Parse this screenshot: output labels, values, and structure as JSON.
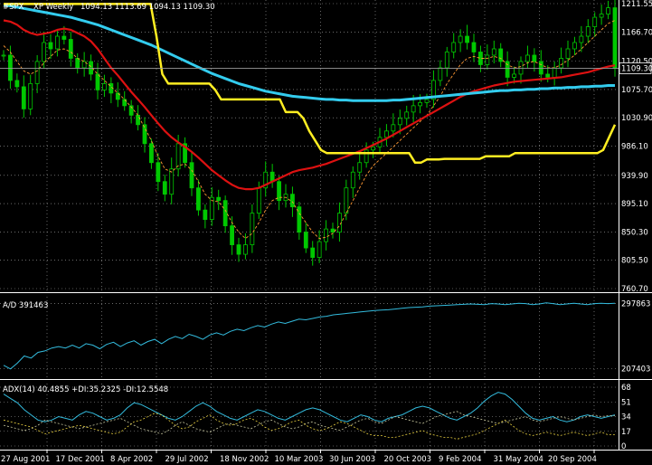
{
  "header": {
    "symbol": "#SPX",
    "timeframe": "XP Weekly",
    "ohlc": "1094.13 1113.69 1094.13 1109.30",
    "current_price": "1109.30"
  },
  "colors": {
    "background": "#000000",
    "grid": "#a9a9a9",
    "candles": "#00c800",
    "ma_fast": "#ff9933",
    "ma_mid": "#dd1111",
    "ma_slow": "#33ccee",
    "stop_line": "#ffee22",
    "ad_line": "#33bbdd",
    "adx_main": "#33bbdd",
    "adx_plus": "#c8c8a0",
    "adx_minus": "#e8d040",
    "price_marker": "#000000"
  },
  "chart_data": [
    {
      "type": "line",
      "name": "price",
      "title": "#SPX, XP Weekly",
      "y_ticks": [
        "1211.55",
        "1166.70",
        "1120.50",
        "1075.70",
        "1030.90",
        "986.10",
        "939.90",
        "895.10",
        "850.30",
        "805.50",
        "760.70"
      ],
      "ylim": [
        760.7,
        1211.55
      ],
      "x_labels": [
        "27 Aug 2001",
        "17 Dec 2001",
        "8 Apr 2002",
        "29 Jul 2002",
        "18 Nov 2002",
        "10 Mar 2003",
        "30 Jun 2003",
        "20 Oct 2003",
        "9 Feb 2004",
        "31 May 2004",
        "20 Sep 2004"
      ],
      "candles": {
        "close": [
          1130,
          1090,
          1080,
          1045,
          1085,
          1120,
          1150,
          1140,
          1160,
          1155,
          1125,
          1110,
          1120,
          1100,
          1075,
          1085,
          1070,
          1060,
          1050,
          1035,
          1020,
          990,
          960,
          930,
          910,
          950,
          990,
          960,
          920,
          885,
          870,
          905,
          900,
          860,
          830,
          815,
          830,
          880,
          920,
          945,
          930,
          900,
          910,
          890,
          850,
          825,
          810,
          835,
          855,
          850,
          880,
          920,
          945,
          960,
          980,
          985,
          1000,
          1010,
          1020,
          1030,
          1040,
          1050,
          1055,
          1060,
          1090,
          1110,
          1135,
          1150,
          1160,
          1150,
          1135,
          1115,
          1130,
          1140,
          1120,
          1095,
          1100,
          1120,
          1130,
          1120,
          1100,
          1095,
          1110,
          1125,
          1140,
          1150,
          1160,
          1175,
          1190,
          1195,
          1205,
          1109
        ]
      },
      "series": [
        {
          "name": "ma_fast",
          "values": [
            1145,
            1135,
            1120,
            1105,
            1100,
            1105,
            1118,
            1128,
            1138,
            1140,
            1135,
            1125,
            1120,
            1112,
            1100,
            1090,
            1080,
            1070,
            1060,
            1048,
            1035,
            1015,
            995,
            970,
            950,
            945,
            955,
            958,
            948,
            930,
            910,
            900,
            898,
            885,
            865,
            850,
            840,
            848,
            865,
            885,
            900,
            905,
            905,
            898,
            880,
            865,
            850,
            840,
            842,
            848,
            860,
            880,
            900,
            920,
            940,
            955,
            965,
            975,
            985,
            995,
            1005,
            1015,
            1025,
            1035,
            1050,
            1065,
            1085,
            1100,
            1115,
            1125,
            1128,
            1125,
            1125,
            1128,
            1125,
            1115,
            1110,
            1112,
            1118,
            1120,
            1115,
            1110,
            1110,
            1115,
            1122,
            1130,
            1140,
            1150,
            1160,
            1170,
            1180,
            1185
          ]
        },
        {
          "name": "ma_mid",
          "values": [
            1185,
            1183,
            1178,
            1170,
            1165,
            1162,
            1164,
            1166,
            1170,
            1172,
            1170,
            1165,
            1160,
            1152,
            1140,
            1125,
            1110,
            1098,
            1085,
            1072,
            1060,
            1048,
            1035,
            1022,
            1010,
            1000,
            992,
            985,
            977,
            968,
            958,
            948,
            940,
            932,
            925,
            920,
            918,
            918,
            920,
            925,
            930,
            935,
            940,
            945,
            948,
            950,
            952,
            955,
            958,
            962,
            966,
            970,
            974,
            978,
            983,
            988,
            993,
            998,
            1004,
            1010,
            1016,
            1022,
            1028,
            1034,
            1040,
            1046,
            1052,
            1058,
            1064,
            1069,
            1073,
            1076,
            1079,
            1082,
            1084,
            1086,
            1088,
            1089,
            1090,
            1091,
            1092,
            1093,
            1094,
            1095,
            1097,
            1099,
            1101,
            1103,
            1106,
            1109,
            1112,
            1114
          ]
        },
        {
          "name": "ma_slow",
          "values": [
            1210,
            1208,
            1206,
            1204,
            1202,
            1200,
            1198,
            1196,
            1194,
            1192,
            1190,
            1187,
            1184,
            1181,
            1178,
            1174,
            1170,
            1166,
            1162,
            1158,
            1154,
            1150,
            1146,
            1141,
            1136,
            1131,
            1126,
            1121,
            1116,
            1111,
            1106,
            1101,
            1097,
            1093,
            1089,
            1085,
            1082,
            1079,
            1076,
            1073,
            1071,
            1069,
            1067,
            1065,
            1064,
            1063,
            1062,
            1061,
            1060,
            1060,
            1059,
            1059,
            1058,
            1058,
            1058,
            1058,
            1058,
            1058,
            1059,
            1059,
            1060,
            1061,
            1062,
            1063,
            1064,
            1065,
            1066,
            1067,
            1068,
            1069,
            1070,
            1071,
            1072,
            1073,
            1074,
            1074,
            1075,
            1075,
            1076,
            1076,
            1077,
            1077,
            1078,
            1078,
            1079,
            1079,
            1080,
            1080,
            1081,
            1081,
            1082,
            1082
          ]
        },
        {
          "name": "stop_line",
          "values": [
            1211,
            1211,
            1211,
            1211,
            1211,
            1211,
            1211,
            1211,
            1211,
            1211,
            1211,
            1211,
            1211,
            1211,
            1211,
            1211,
            1211,
            1211,
            1211,
            1211,
            1211,
            1211,
            1211,
            1211,
            1211,
            1211,
            1160,
            1100,
            1085,
            1085,
            1085,
            1085,
            1085,
            1085,
            1085,
            1085,
            1075,
            1060,
            1060,
            1060,
            1060,
            1060,
            1060,
            1060,
            1060,
            1060,
            1060,
            1060,
            1040,
            1040,
            1040,
            1030,
            1010,
            995,
            980,
            975,
            975,
            975,
            975,
            975,
            975,
            975,
            975,
            975,
            975,
            975,
            975,
            975,
            975,
            975,
            960,
            960,
            965,
            965,
            965,
            966,
            966,
            966,
            966,
            966,
            966,
            966,
            970,
            970,
            970,
            970,
            970,
            975,
            975,
            975,
            975,
            975,
            975,
            975,
            975,
            975,
            975,
            975,
            975,
            975,
            975,
            975,
            980,
            1000,
            1020
          ]
        }
      ]
    },
    {
      "type": "line",
      "name": "A/D",
      "title": "A/D 391463",
      "y_ticks": [
        "297863",
        "207403"
      ],
      "ylim": [
        198000,
        302000
      ],
      "series": [
        {
          "name": "A/D",
          "values": [
            212000,
            207000,
            215000,
            225000,
            222000,
            230000,
            232000,
            236000,
            238000,
            236000,
            240000,
            236000,
            242000,
            240000,
            235000,
            241000,
            244000,
            238000,
            243000,
            246000,
            240000,
            245000,
            248000,
            242000,
            248000,
            252000,
            249000,
            255000,
            252000,
            248000,
            254000,
            257000,
            254000,
            259000,
            262000,
            260000,
            264000,
            267000,
            265000,
            269000,
            272000,
            270000,
            273000,
            276000,
            275000,
            277000,
            279000,
            280000,
            282000,
            283000,
            284000,
            285000,
            286000,
            287000,
            288000,
            288500,
            289000,
            290000,
            291000,
            292000,
            292500,
            293000,
            294000,
            294500,
            295000,
            295500,
            296000,
            296500,
            297000,
            296500,
            296000,
            297500,
            297000,
            296000,
            297000,
            298000,
            297500,
            296000,
            297000,
            298500,
            297500,
            296000,
            297000,
            298000,
            297000,
            296000,
            297500,
            298000,
            297500,
            297863
          ]
        }
      ]
    },
    {
      "type": "line",
      "name": "ADX",
      "title": "ADX(14) 40.4855 +DI:35.2325 -DI:12.5548",
      "y_ticks": [
        "68",
        "51",
        "34",
        "17",
        "0"
      ],
      "ylim": [
        0,
        68
      ],
      "series": [
        {
          "name": "ADX",
          "values": [
            60,
            55,
            50,
            42,
            36,
            30,
            28,
            30,
            34,
            32,
            30,
            36,
            40,
            38,
            34,
            30,
            32,
            36,
            44,
            50,
            48,
            44,
            40,
            36,
            32,
            30,
            34,
            40,
            46,
            50,
            46,
            40,
            36,
            32,
            30,
            34,
            38,
            42,
            40,
            36,
            32,
            30,
            34,
            38,
            42,
            44,
            42,
            38,
            34,
            30,
            28,
            32,
            36,
            34,
            30,
            28,
            32,
            34,
            36,
            40,
            44,
            46,
            44,
            40,
            36,
            32,
            30,
            34,
            38,
            44,
            52,
            58,
            62,
            60,
            54,
            46,
            38,
            32,
            30,
            32,
            34,
            30,
            28,
            30,
            34,
            36,
            34,
            32,
            34,
            36
          ]
        },
        {
          "name": "+DI",
          "values": [
            24,
            22,
            20,
            18,
            20,
            24,
            30,
            28,
            26,
            24,
            22,
            20,
            22,
            24,
            26,
            28,
            30,
            32,
            28,
            24,
            20,
            18,
            16,
            14,
            18,
            24,
            28,
            24,
            20,
            18,
            16,
            20,
            24,
            26,
            24,
            22,
            20,
            24,
            28,
            30,
            26,
            22,
            20,
            22,
            26,
            28,
            24,
            22,
            20,
            18,
            22,
            26,
            30,
            32,
            28,
            26,
            30,
            34,
            32,
            30,
            28,
            26,
            30,
            34,
            36,
            38,
            40,
            36,
            34,
            32,
            30,
            28,
            26,
            28,
            30,
            32,
            34,
            30,
            28,
            30,
            32,
            34,
            32,
            30,
            32,
            34,
            36,
            34,
            35,
            35
          ]
        },
        {
          "name": "-DI",
          "values": [
            30,
            28,
            26,
            24,
            22,
            18,
            14,
            16,
            18,
            20,
            22,
            24,
            22,
            20,
            18,
            16,
            14,
            16,
            22,
            28,
            30,
            34,
            38,
            36,
            30,
            24,
            20,
            22,
            28,
            32,
            36,
            30,
            26,
            24,
            26,
            30,
            32,
            28,
            22,
            18,
            20,
            24,
            28,
            30,
            24,
            20,
            18,
            20,
            24,
            28,
            26,
            22,
            18,
            14,
            12,
            12,
            10,
            10,
            12,
            14,
            16,
            18,
            14,
            12,
            10,
            10,
            8,
            10,
            12,
            14,
            18,
            22,
            26,
            30,
            24,
            18,
            14,
            12,
            14,
            16,
            14,
            12,
            14,
            16,
            14,
            12,
            14,
            16,
            13,
            13
          ]
        }
      ]
    }
  ]
}
